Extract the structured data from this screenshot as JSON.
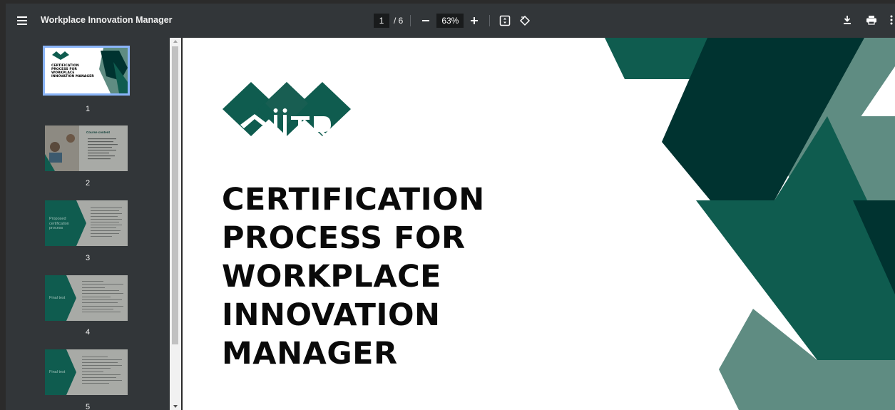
{
  "toolbar": {
    "title": "Workplace Innovation Manager",
    "current_page": "1",
    "page_separator": "/ 6",
    "zoom": "63%",
    "menu_icon": "menu-icon",
    "zoom_out_icon": "minus-icon",
    "zoom_in_icon": "plus-icon",
    "fit_icon": "fit-to-page-icon",
    "rotate_icon": "rotate-icon",
    "download_icon": "download-icon",
    "print_icon": "print-icon",
    "more_icon": "more-vert-icon"
  },
  "sidebar": {
    "thumbnails": [
      {
        "number": "1",
        "heading": "CERTIFICATION PROCESS FOR WORKPLACE INNOVATION MANAGER"
      },
      {
        "number": "2",
        "heading": "Course content"
      },
      {
        "number": "3",
        "heading": "Proposed certification process"
      },
      {
        "number": "4",
        "heading": "Final test"
      },
      {
        "number": "5",
        "heading": "Final test"
      }
    ]
  },
  "document": {
    "title_lines": [
      "CERTIFICATION",
      "PROCESS FOR",
      "WORKPLACE",
      "INNOVATION",
      "MANAGER"
    ],
    "logo_text": "MiiTR"
  },
  "colors": {
    "dark_green": "#003330",
    "mid_green": "#0f5c4f",
    "light_green": "#5f8c82",
    "toolbar_bg": "#323639",
    "selected_outline": "#8ab4f8"
  }
}
